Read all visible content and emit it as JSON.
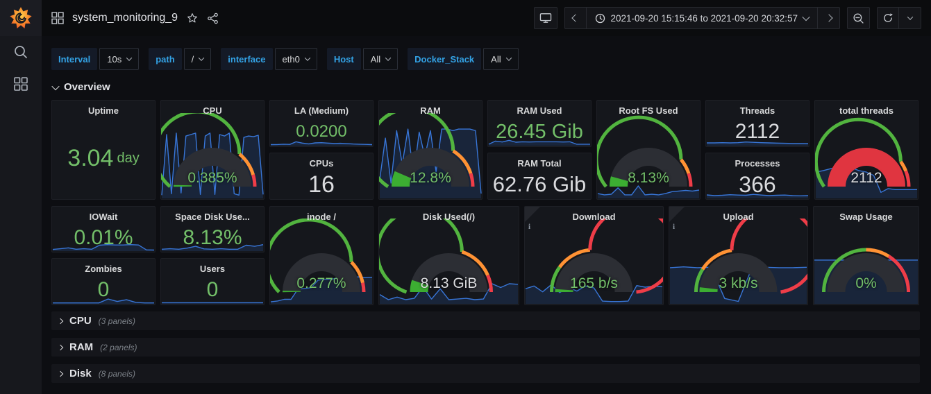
{
  "topbar": {
    "title": "system_monitoring_9",
    "icons": [
      "dashboard-grid",
      "star",
      "share",
      "tv-kiosk",
      "prev-range",
      "clock",
      "next-range",
      "zoom-out",
      "refresh",
      "refresh-interval"
    ]
  },
  "time": {
    "range": "2021-09-20 15:15:46 to 2021-09-20 20:32:57"
  },
  "filters": [
    {
      "label": "Interval",
      "value": "10s"
    },
    {
      "label": "path",
      "value": "/"
    },
    {
      "label": "interface",
      "value": "eth0"
    },
    {
      "label": "Host",
      "value": "All"
    },
    {
      "label": "Docker_Stack",
      "value": "All"
    }
  ],
  "section": {
    "title": "Overview"
  },
  "colors": {
    "value_green": "#73BF69",
    "value_white": "#dadbde",
    "ring_green": "#52b43f",
    "ring_orange": "#ff9234",
    "ring_red": "#ef3d48",
    "fill_green": "#3cae32",
    "fill_red": "#e03540",
    "gauge_track": "#2c2e34",
    "spark_line": "#3876d8",
    "spark_fill": "rgba(51,115,216,0.16)",
    "accent_blue": "#33a2e5"
  },
  "rows": [
    {
      "cells": [
        {
          "panels": [
            {
              "id": "uptime",
              "title": "Uptime",
              "type": "stat",
              "value": "3.04",
              "unit": "day",
              "color": "green",
              "spark": null
            }
          ]
        },
        {
          "panels": [
            {
              "id": "cpu",
              "title": "CPU",
              "type": "gauge",
              "value": "0.385%",
              "color": "green",
              "fill": 0.015,
              "fill_color": "green",
              "ring": [
                [
                  0,
                  0.72,
                  "g"
                ],
                [
                  0.72,
                  0.91,
                  "o"
                ],
                [
                  0.91,
                  1,
                  "r"
                ]
              ],
              "spark": [
                0.04,
                0.88,
                0.06,
                0.9,
                0.07,
                0.86,
                0.88,
                0.9,
                0.05,
                0.86,
                0.9,
                0.05,
                0.88,
                0.86,
                0.9,
                0.06,
                0.04,
                0.84,
                0.86,
                0.85,
                0.87,
                0.05
              ],
              "spark_h": 0.75
            }
          ]
        },
        {
          "panels": [
            {
              "id": "la-medium",
              "title": "LA (Medium)",
              "type": "stat",
              "value": "0.0200",
              "color": "green",
              "spark": [
                0.06,
                0.07,
                0.1,
                0.08,
                0.32,
                0.2,
                0.13,
                0.22,
                0.24,
                0.2,
                0.17,
                0.18,
                0.15,
                0.12,
                0.1,
                0.08,
                0.06
              ]
            },
            {
              "id": "cpus",
              "title": "CPUs",
              "type": "stat",
              "value": "16",
              "color": "white",
              "spark": null
            }
          ]
        },
        {
          "panels": [
            {
              "id": "ram",
              "title": "RAM",
              "type": "gauge",
              "value": "12.8%",
              "color": "green",
              "fill": 0.13,
              "fill_color": "green",
              "ring": [
                [
                  0,
                  0.68,
                  "g"
                ],
                [
                  0.68,
                  0.9,
                  "o"
                ],
                [
                  0.9,
                  1,
                  "r"
                ]
              ],
              "spark": [
                0.25,
                0.8,
                0.2,
                0.9,
                0.45,
                0.92,
                0.3,
                0.88,
                0.55,
                0.9,
                0.35,
                0.92,
                0.92,
                0.9,
                0.92,
                0.92,
                0.92,
                0.9,
                0.06
              ],
              "spark_h": 0.78
            }
          ]
        },
        {
          "panels": [
            {
              "id": "ram-used",
              "title": "RAM Used",
              "type": "stat",
              "value": "26.45 Gib",
              "color": "green",
              "spark": [
                0.1,
                0.38,
                0.3,
                0.45,
                0.28,
                0.32,
                0.3,
                0.32,
                0.32,
                0.32,
                0.32,
                0.3,
                0.32,
                0.1,
                0.1,
                0.1
              ]
            },
            {
              "id": "ram-total",
              "title": "RAM Total",
              "type": "stat",
              "value": "62.76 Gib",
              "color": "white",
              "spark": null
            }
          ]
        },
        {
          "panels": [
            {
              "id": "root-fs-used",
              "title": "Root FS Used",
              "type": "gauge",
              "value": "8.13%",
              "color": "green",
              "fill": 0.085,
              "fill_color": "green",
              "ring": [
                [
                  0,
                  0.78,
                  "g"
                ],
                [
                  0.78,
                  0.9,
                  "o"
                ],
                [
                  0.9,
                  1,
                  "r"
                ]
              ],
              "spark": [
                0.14,
                0.1,
                0.12,
                0.32,
                0.1,
                0.1,
                0.38,
                0.1,
                0.12,
                0.1,
                0.14,
                0.2,
                0.22,
                0.24,
                0.22,
                0.25
              ],
              "spark_h": 0.35
            }
          ]
        },
        {
          "panels": [
            {
              "id": "threads",
              "title": "Threads",
              "type": "stat",
              "value": "2112",
              "color": "white",
              "spark": [
                0.22,
                0.22,
                0.24,
                0.22,
                0.24,
                0.3,
                0.27,
                0.24,
                0.22,
                0.2,
                0.18,
                0.17,
                0.17,
                0.16
              ]
            },
            {
              "id": "processes",
              "title": "Processes",
              "type": "stat",
              "value": "366",
              "color": "white",
              "spark": [
                0.28,
                0.22,
                0.25,
                0.3,
                0.27,
                0.25,
                0.33,
                0.27,
                0.22,
                0.25,
                0.27,
                0.22,
                0.2,
                0.22
              ]
            }
          ]
        },
        {
          "panels": [
            {
              "id": "total-threads",
              "title": "total threads",
              "type": "gauge",
              "value": "2112",
              "color": "white",
              "fill": 1,
              "fill_color": "red",
              "ring": [
                [
                  0,
                  0.8,
                  "g"
                ],
                [
                  0.8,
                  0.88,
                  "o"
                ],
                [
                  0.88,
                  1,
                  "r"
                ]
              ],
              "spark": [
                0.55,
                0.58,
                0.62,
                0.66,
                0.62,
                0.64,
                0.58,
                0.55,
                0.48,
                0.12,
                0.2,
                0.18,
                0.18,
                0.18,
                0.18
              ],
              "spark_h": 0.5
            }
          ]
        }
      ]
    },
    {
      "cells": [
        {
          "panels": [
            {
              "id": "iowait",
              "title": "IOWait",
              "type": "stat",
              "value": "0.01%",
              "color": "green",
              "spark": [
                0.12,
                0.18,
                0.26,
                0.14,
                0.18,
                0.14,
                0.5,
                0.55,
                0.52,
                0.52,
                0.55,
                0.52,
                0.08,
                0.07
              ]
            },
            {
              "id": "zombies",
              "title": "Zombies",
              "type": "stat",
              "value": "0",
              "color": "green",
              "spark": [
                0.05,
                0.05,
                0.05,
                0.05,
                0.05,
                0.05,
                0.4,
                0.18,
                0.34,
                0.1,
                0.05,
                0.05
              ]
            }
          ]
        },
        {
          "panels": [
            {
              "id": "space-disk-use",
              "title": "Space Disk Use...",
              "type": "stat",
              "value": "8.13%",
              "color": "green",
              "spark": [
                0.14,
                0.18,
                0.14,
                0.24,
                0.4,
                0.17,
                0.14,
                0.18,
                0.14,
                0.14,
                0.5,
                0.4,
                0.55
              ]
            },
            {
              "id": "users",
              "title": "Users",
              "type": "stat",
              "value": "0",
              "color": "green",
              "spark": [
                0.07,
                0.07,
                0.07,
                0.07,
                0.07,
                0.07,
                0.07,
                0.07,
                0.07,
                0.07
              ]
            }
          ]
        },
        {
          "panels": [
            {
              "id": "inode-root",
              "title": "inode /",
              "type": "gauge",
              "value": "0.277%",
              "color": "green",
              "fill": 0.012,
              "fill_color": "green",
              "ring": [
                [
                  0,
                  0.75,
                  "g"
                ],
                [
                  0.75,
                  0.93,
                  "o"
                ],
                [
                  0.93,
                  1,
                  "r"
                ]
              ],
              "spark": [
                0.04,
                0.06,
                0.1,
                0.1,
                0.34,
                0.36,
                0.38,
                0.56,
                0.58,
                0.58,
                0.62,
                0.6,
                0.62,
                0.64,
                0.62,
                0.63
              ],
              "spark_h": 0.45
            }
          ]
        },
        {
          "panels": [
            {
              "id": "disk-used-root",
              "title": "Disk Used(/)",
              "type": "gauge",
              "value": "8.13 GiB",
              "color": "white",
              "fill": 0.1,
              "fill_color": "green",
              "ring": [
                [
                  0,
                  0.6,
                  "g"
                ],
                [
                  0.6,
                  0.87,
                  "o"
                ],
                [
                  0.87,
                  1,
                  "r"
                ]
              ],
              "spark": [
                0.28,
                0.12,
                0.2,
                0.12,
                0.16,
                0.52,
                0.14,
                0.46,
                0.12,
                0.14,
                0.16,
                0.12,
                0.14,
                0.62,
                0.5,
                0.62,
                0.6
              ],
              "spark_h": 0.35
            }
          ]
        },
        {
          "panels": [
            {
              "id": "download",
              "title": "Download",
              "type": "gauge",
              "info": true,
              "value": "165 b/s",
              "color": "green",
              "fill": 0.025,
              "fill_color": "green",
              "ring": [
                [
                  0,
                  0.2,
                  "g"
                ],
                [
                  0.2,
                  0.47,
                  "o"
                ],
                [
                  0.47,
                  1,
                  "r"
                ]
              ],
              "spark": [
                0.38,
                0.45,
                0.3,
                0.48,
                0.28,
                0.42,
                0.32,
                0.45,
                0.4,
                0.06,
                0.05,
                0.05,
                0.06,
                0.46,
                0.42,
                0.45,
                0.43
              ],
              "spark_h": 0.42
            }
          ]
        },
        {
          "panels": [
            {
              "id": "upload",
              "title": "Upload",
              "type": "gauge",
              "info": true,
              "value": "3 kb/s",
              "color": "green",
              "fill": 0.04,
              "fill_color": "green",
              "ring": [
                [
                  0,
                  0.18,
                  "g"
                ],
                [
                  0.18,
                  0.45,
                  "o"
                ],
                [
                  0.45,
                  1,
                  "r"
                ]
              ],
              "spark": [
                0.86,
                0.88,
                0.86,
                0.87,
                0.12,
                0.05,
                0.86,
                0.87,
                0.86,
                0.86,
                0.87
              ],
              "spark_h": 0.45
            }
          ]
        },
        {
          "panels": [
            {
              "id": "swap-usage",
              "title": "Swap Usage",
              "type": "gauge",
              "value": "0%",
              "color": "green",
              "fill": 0,
              "fill_color": "green",
              "ring": [
                [
                  0,
                  0.5,
                  "g"
                ],
                [
                  0.5,
                  0.68,
                  "o"
                ],
                [
                  0.68,
                  1,
                  "r"
                ]
              ],
              "spark": [
                0.92,
                0.92,
                0.92,
                0.92,
                0.92,
                0.92
              ],
              "spark_h": 0.5
            }
          ]
        }
      ]
    }
  ],
  "collapsed_rows": [
    {
      "title": "CPU",
      "count": "(3 panels)"
    },
    {
      "title": "RAM",
      "count": "(2 panels)"
    },
    {
      "title": "Disk",
      "count": "(8 panels)"
    }
  ]
}
